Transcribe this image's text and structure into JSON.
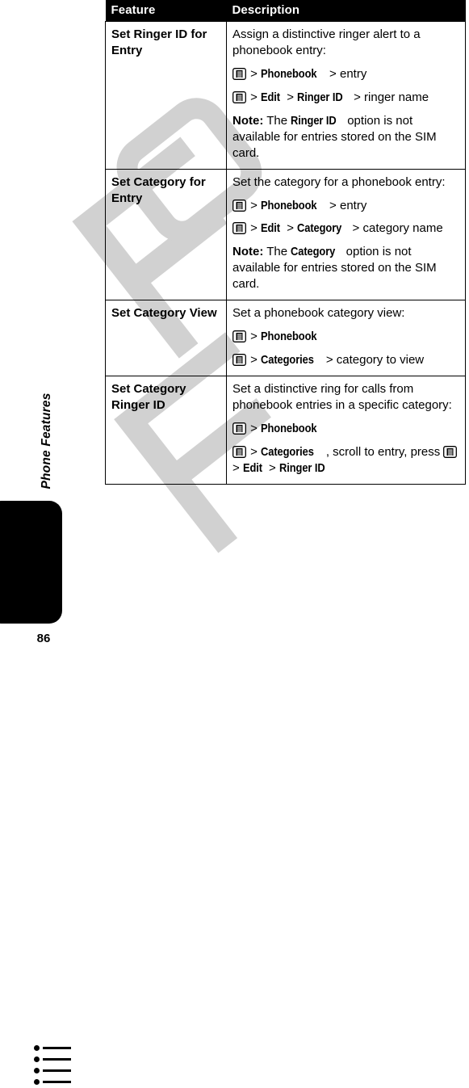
{
  "page": {
    "number": "86",
    "section_label": "Phone Features",
    "tab_icon": "bulleted-list-icon",
    "colors": {
      "ink": "#000000",
      "paper": "#ffffff",
      "watermark": "#c9c9c9"
    }
  },
  "table": {
    "headers": {
      "feature": "Feature",
      "description": "Description"
    },
    "rows": [
      {
        "feature": "Set Ringer ID for Entry",
        "blocks": [
          {
            "type": "text",
            "text": "Assign a distinctive ringer alert to a phonebook entry:"
          },
          {
            "type": "path",
            "parts": [
              {
                "kind": "key",
                "icon": "menu-key-icon"
              },
              {
                "kind": "sep",
                "text": ">"
              },
              {
                "kind": "menu",
                "text": "Phonebook"
              },
              {
                "kind": "sep",
                "text": ">"
              },
              {
                "kind": "plain",
                "text": "entry"
              }
            ]
          },
          {
            "type": "path",
            "parts": [
              {
                "kind": "key",
                "icon": "menu-key-icon"
              },
              {
                "kind": "sep",
                "text": ">"
              },
              {
                "kind": "menu",
                "text": "Edit"
              },
              {
                "kind": "sep",
                "text": ">"
              },
              {
                "kind": "menu",
                "text": "Ringer ID"
              },
              {
                "kind": "sep",
                "text": ">"
              },
              {
                "kind": "plain",
                "text": "ringer name"
              }
            ]
          },
          {
            "type": "note",
            "label": "Note:",
            "parts": [
              {
                "kind": "plain",
                "text": "The"
              },
              {
                "kind": "menu",
                "text": "Ringer ID"
              },
              {
                "kind": "plain",
                "text": "option is not available for entries stored on the SIM card."
              }
            ]
          }
        ]
      },
      {
        "feature": "Set Category for Entry",
        "blocks": [
          {
            "type": "text",
            "text": "Set the category for a phonebook entry:"
          },
          {
            "type": "path",
            "parts": [
              {
                "kind": "key",
                "icon": "menu-key-icon"
              },
              {
                "kind": "sep",
                "text": ">"
              },
              {
                "kind": "menu",
                "text": "Phonebook"
              },
              {
                "kind": "sep",
                "text": ">"
              },
              {
                "kind": "plain",
                "text": "entry"
              }
            ]
          },
          {
            "type": "path",
            "parts": [
              {
                "kind": "key",
                "icon": "menu-key-icon"
              },
              {
                "kind": "sep",
                "text": ">"
              },
              {
                "kind": "menu",
                "text": "Edit"
              },
              {
                "kind": "sep",
                "text": ">"
              },
              {
                "kind": "menu",
                "text": "Category"
              },
              {
                "kind": "sep",
                "text": ">"
              },
              {
                "kind": "plain",
                "text": "category name"
              }
            ]
          },
          {
            "type": "note",
            "label": "Note:",
            "parts": [
              {
                "kind": "plain",
                "text": "The"
              },
              {
                "kind": "menu",
                "text": "Category"
              },
              {
                "kind": "plain",
                "text": "option is not available for entries stored on the SIM card."
              }
            ]
          }
        ]
      },
      {
        "feature": "Set Category View",
        "blocks": [
          {
            "type": "text",
            "text": "Set a phonebook category view:"
          },
          {
            "type": "path",
            "parts": [
              {
                "kind": "key",
                "icon": "menu-key-icon"
              },
              {
                "kind": "sep",
                "text": ">"
              },
              {
                "kind": "menu",
                "text": "Phonebook"
              }
            ]
          },
          {
            "type": "path",
            "parts": [
              {
                "kind": "key",
                "icon": "menu-key-icon"
              },
              {
                "kind": "sep",
                "text": ">"
              },
              {
                "kind": "menu",
                "text": "Categories"
              },
              {
                "kind": "sep",
                "text": ">"
              },
              {
                "kind": "plain",
                "text": "category to view"
              }
            ]
          }
        ]
      },
      {
        "feature": "Set Category Ringer ID",
        "blocks": [
          {
            "type": "text",
            "text": "Set a distinctive ring for calls from phonebook entries in a specific category:"
          },
          {
            "type": "path",
            "parts": [
              {
                "kind": "key",
                "icon": "menu-key-icon"
              },
              {
                "kind": "sep",
                "text": ">"
              },
              {
                "kind": "menu",
                "text": "Phonebook"
              }
            ]
          },
          {
            "type": "path",
            "parts": [
              {
                "kind": "key",
                "icon": "menu-key-icon"
              },
              {
                "kind": "sep",
                "text": ">"
              },
              {
                "kind": "menu",
                "text": "Categories"
              },
              {
                "kind": "plain",
                "text": ", scroll to entry, press"
              },
              {
                "kind": "key",
                "icon": "menu-key-icon"
              },
              {
                "kind": "sep",
                "text": ">"
              },
              {
                "kind": "menu",
                "text": "Edit"
              },
              {
                "kind": "sep",
                "text": ">"
              },
              {
                "kind": "menu",
                "text": "Ringer ID"
              }
            ]
          }
        ]
      }
    ]
  }
}
